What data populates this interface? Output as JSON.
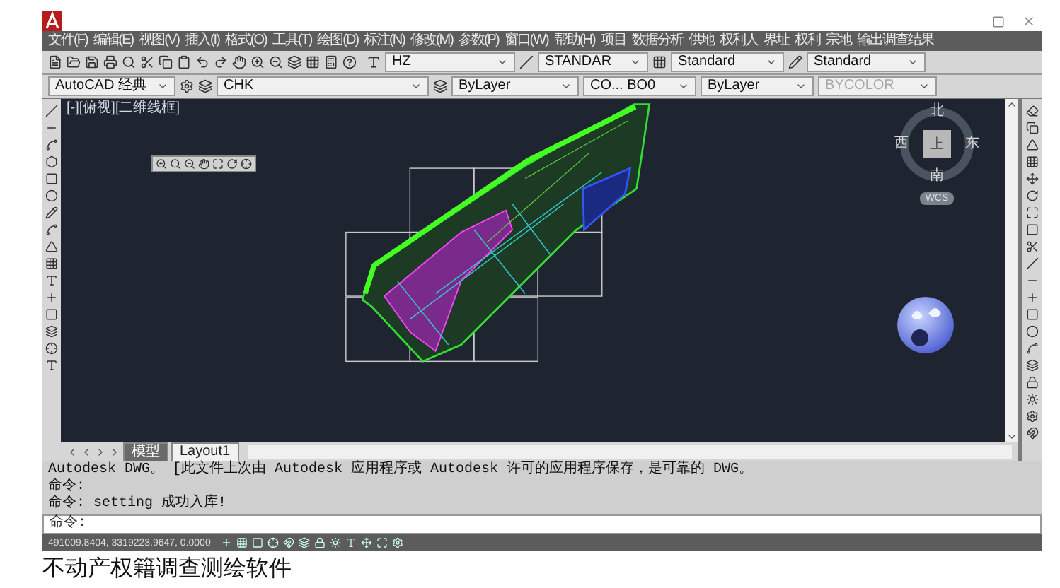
{
  "menu": [
    "文件(F)",
    "编辑(E)",
    "视图(V)",
    "插入(I)",
    "格式(O)",
    "工具(T)",
    "绘图(D)",
    "标注(N)",
    "修改(M)",
    "参数(P)",
    "窗口(W)",
    "帮助(H)",
    "项目",
    "数据分析",
    "供地",
    "权利人",
    "界址",
    "权利",
    "宗地",
    "输出调查结果"
  ],
  "styles": {
    "text_style": "HZ",
    "dim_style": "STANDAR",
    "table_style": "Standard",
    "multileader_style": "Standard"
  },
  "properties": {
    "workspace": "AutoCAD 经典",
    "layer": "CHK",
    "color_control": "ByLayer",
    "linetype": "CO... BO0",
    "lineweight": "ByLayer",
    "plot_style": {
      "value": "BYCOLOR",
      "disabled": true
    }
  },
  "viewport_label": "[-][俯视][二维线框]",
  "view_cube": {
    "north": "北",
    "east": "东",
    "south": "南",
    "west": "西",
    "face": "上",
    "ucs": "WCS"
  },
  "layout_tabs": [
    {
      "label": "模型",
      "selected": true
    },
    {
      "label": "Layout1",
      "selected": false
    }
  ],
  "command_history": [
    "Autodesk DWG。 [此文件上次由 Autodesk 应用程序或 Autodesk 许可的应用程序保存，是可靠的 DWG。",
    "命令:",
    "命令: setting 成功入库!"
  ],
  "command_prompt": "命令:",
  "status_bar": {
    "coordinates": "491009.8404, 3319223.9647, 0.0000"
  },
  "caption": "不动产权籍调查测绘软件"
}
